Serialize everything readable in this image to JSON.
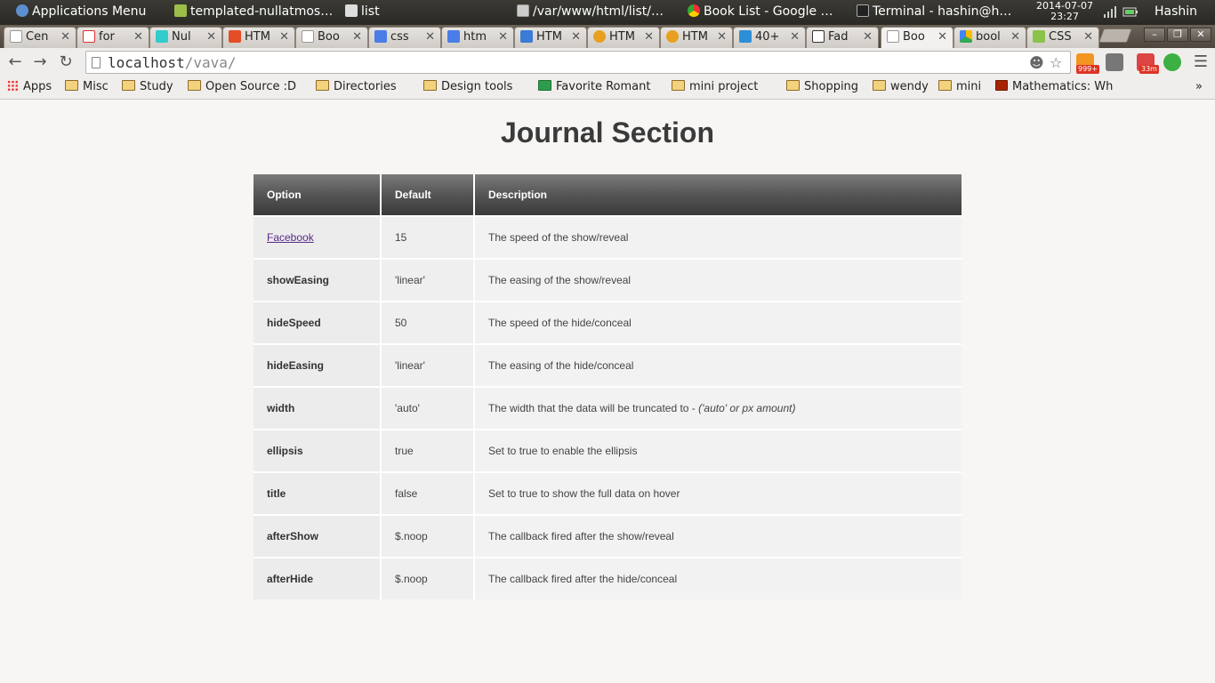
{
  "panel": {
    "apps_menu": "Applications Menu",
    "windows": [
      "templated-nullatmos…",
      "list",
      "/var/www/html/list/…",
      "Book List - Google …",
      "Terminal - hashin@h…"
    ],
    "date": "2014-07-07",
    "time": "23:27",
    "user": "Hashin"
  },
  "tabs": [
    {
      "label": "Cen",
      "icon": "page-icon"
    },
    {
      "label": "for",
      "icon": "gmail-icon"
    },
    {
      "label": "Nul",
      "icon": "t-icon"
    },
    {
      "label": "HTM",
      "icon": "html5-icon"
    },
    {
      "label": "Boo",
      "icon": "page-icon"
    },
    {
      "label": "css",
      "icon": "google-icon"
    },
    {
      "label": "htm",
      "icon": "google-icon"
    },
    {
      "label": "HTM",
      "icon": "window-icon"
    },
    {
      "label": "HTM",
      "icon": "flower-icon"
    },
    {
      "label": "HTM",
      "icon": "flower-icon"
    },
    {
      "label": "40+",
      "icon": "f-icon"
    },
    {
      "label": "Fad",
      "icon": "codepen-icon"
    },
    {
      "label": "Boo",
      "icon": "page-icon",
      "active": true
    },
    {
      "label": "bool",
      "icon": "drive-icon"
    },
    {
      "label": "CSS",
      "icon": "w3-icon"
    }
  ],
  "toolbar": {
    "url_host": "localhost",
    "url_path": "/vava/",
    "badges": [
      "999+",
      "33m"
    ]
  },
  "bookmarks": [
    {
      "label": "Apps",
      "icon": "apps-grid-icon"
    },
    {
      "label": "Misc",
      "icon": "folder-icon"
    },
    {
      "label": "Study",
      "icon": "folder-icon"
    },
    {
      "label": "Open Source :D",
      "icon": "folder-icon"
    },
    {
      "label": "Directories",
      "icon": "folder-icon"
    },
    {
      "label": "Design tools",
      "icon": "folder-icon"
    },
    {
      "label": "Favorite Romant",
      "icon": "sheet-icon"
    },
    {
      "label": "mini project",
      "icon": "folder-icon"
    },
    {
      "label": "Shopping",
      "icon": "folder-icon"
    },
    {
      "label": "wendy",
      "icon": "folder-icon"
    },
    {
      "label": "mini",
      "icon": "folder-icon"
    },
    {
      "label": "Mathematics: Wh",
      "icon": "q-icon"
    }
  ],
  "page": {
    "title": "Journal Section",
    "table": {
      "headers": [
        "Option",
        "Default",
        "Description"
      ],
      "rows": [
        {
          "option": "Facebook",
          "link": true,
          "default": "15",
          "description": "The speed of the show/reveal"
        },
        {
          "option": "showEasing",
          "default": "'linear'",
          "description": "The easing of the show/reveal"
        },
        {
          "option": "hideSpeed",
          "default": "50",
          "description": "The speed of the hide/conceal"
        },
        {
          "option": "hideEasing",
          "default": "'linear'",
          "description": "The easing of the hide/conceal"
        },
        {
          "option": "width",
          "default": "'auto'",
          "description": "The width that the data will be truncated to - ",
          "description_em": "('auto' or px amount)"
        },
        {
          "option": "ellipsis",
          "default": "true",
          "description": "Set to true to enable the ellipsis"
        },
        {
          "option": "title",
          "default": "false",
          "description": "Set to true to show the full data on hover"
        },
        {
          "option": "afterShow",
          "default": "$.noop",
          "description": "The callback fired after the show/reveal"
        },
        {
          "option": "afterHide",
          "default": "$.noop",
          "description": "The callback fired after the hide/conceal"
        }
      ]
    }
  },
  "colors": {
    "header_dark": "#3a3a3a",
    "link_visited": "#5a2a8a",
    "cell_bg": "#efefef"
  }
}
